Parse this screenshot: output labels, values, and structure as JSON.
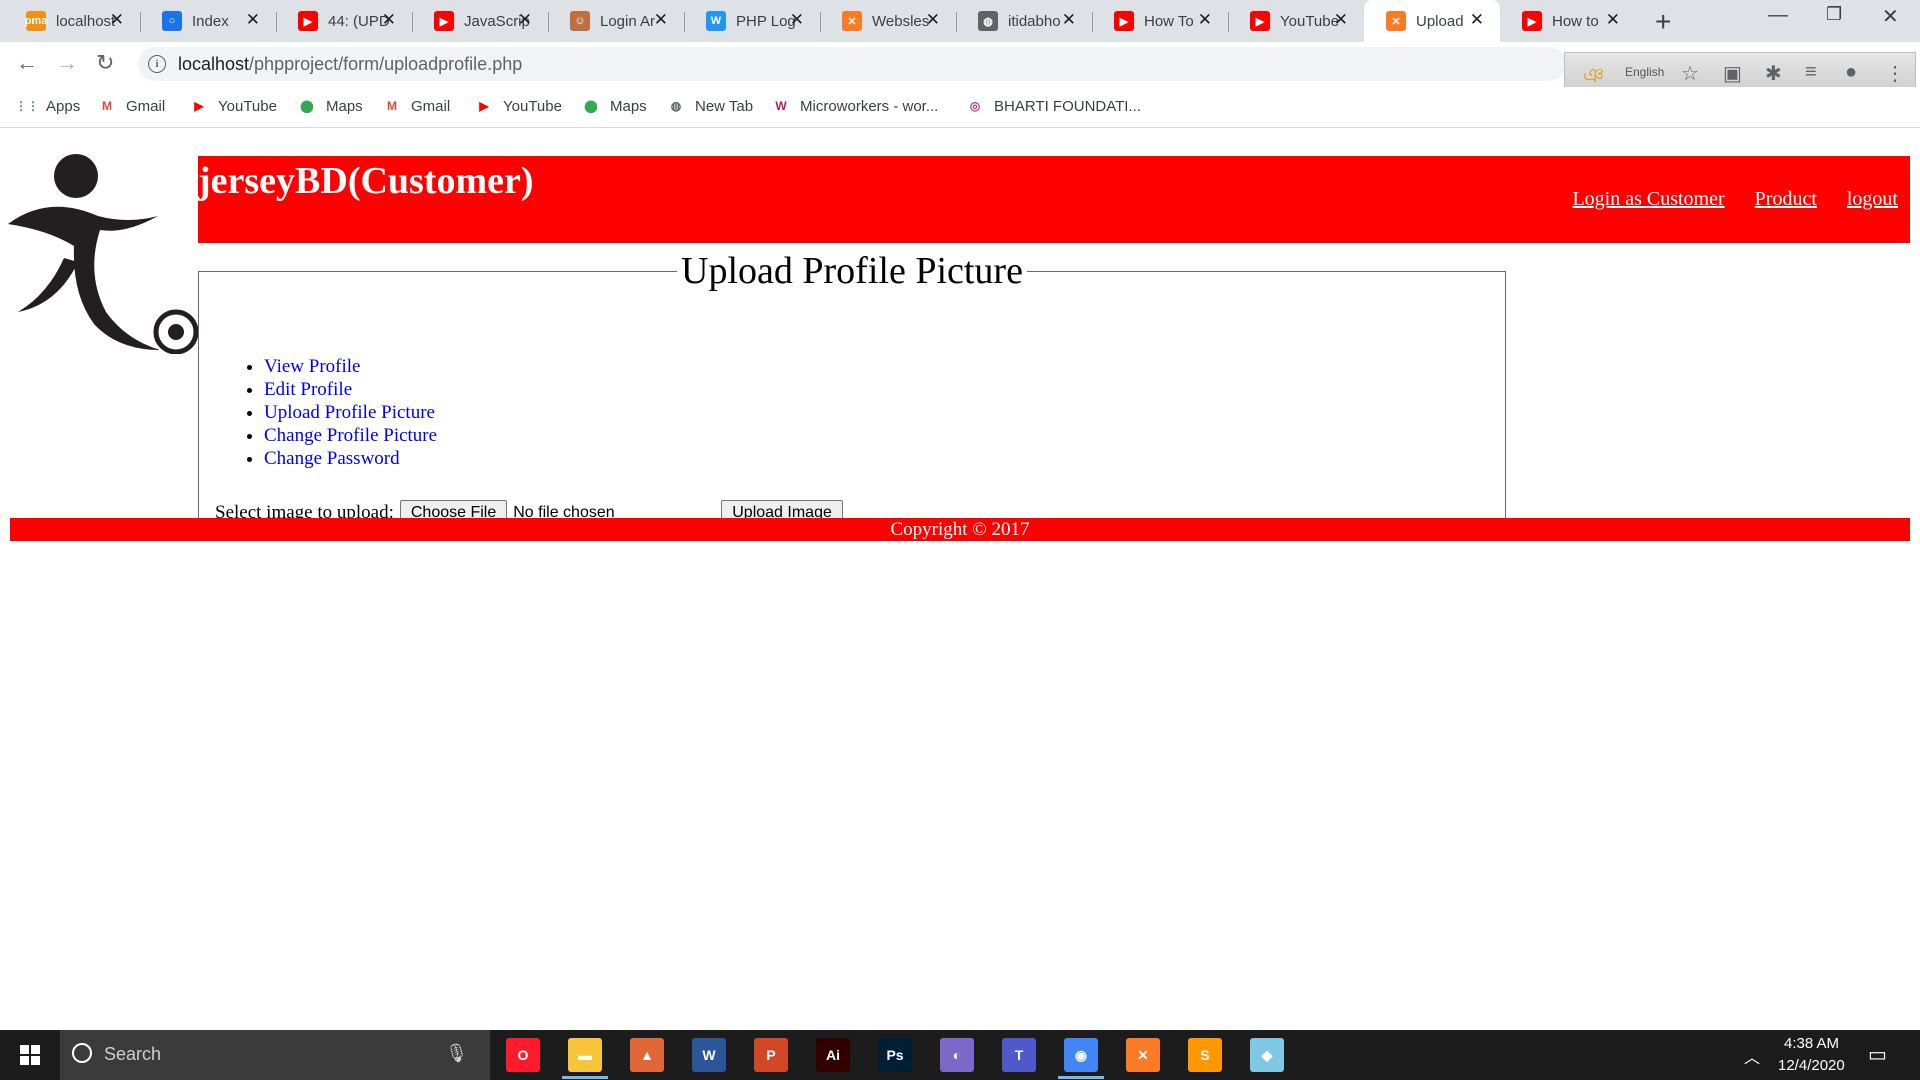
{
  "browser": {
    "tabs": [
      {
        "title": "localhost",
        "icon": "phpmyadmin-icon",
        "color": "#f29111",
        "glyph": "pma"
      },
      {
        "title": "Index",
        "icon": "globe-icon",
        "color": "#1a73e8",
        "glyph": "○"
      },
      {
        "title": "44: (UPD",
        "icon": "youtube-icon",
        "color": "#ff0000",
        "glyph": "▶"
      },
      {
        "title": "JavaScrip",
        "icon": "youtube-icon",
        "color": "#ff0000",
        "glyph": "▶"
      },
      {
        "title": "Login Ar",
        "icon": "avatar-icon",
        "color": "#c07040",
        "glyph": "☺"
      },
      {
        "title": "PHP Log",
        "icon": "w3schools-icon",
        "color": "#2196f3",
        "glyph": "W"
      },
      {
        "title": "Websles",
        "icon": "xampp-icon",
        "color": "#fb7a24",
        "glyph": "✕"
      },
      {
        "title": "itidabho",
        "icon": "globe-icon",
        "color": "#5f6368",
        "glyph": "◍"
      },
      {
        "title": "How To",
        "icon": "youtube-icon",
        "color": "#ff0000",
        "glyph": "▶"
      },
      {
        "title": "YouTube",
        "icon": "youtube-icon",
        "color": "#ff0000",
        "glyph": "▶"
      },
      {
        "title": "Upload",
        "icon": "xampp-icon",
        "color": "#fb7a24",
        "glyph": "✕",
        "active": true
      },
      {
        "title": "How to",
        "icon": "youtube-icon",
        "color": "#ff0000",
        "glyph": "▶"
      }
    ],
    "new_tab_glyph": "+",
    "close_glyph": "✕",
    "url_host": "localhost",
    "url_path": "/phpproject/form/uploadprofile.php",
    "ext_language": "English"
  },
  "bookmarks": [
    {
      "label": "Apps",
      "icon": "apps-grid-icon",
      "color": "#4285f4",
      "glyph": "⋮⋮"
    },
    {
      "label": "Gmail",
      "icon": "gmail-icon",
      "color": "#ea4335",
      "glyph": "M"
    },
    {
      "label": "YouTube",
      "icon": "youtube-icon",
      "color": "#ff0000",
      "glyph": "▶"
    },
    {
      "label": "Maps",
      "icon": "maps-pin-icon",
      "color": "#34a853",
      "glyph": "⬤"
    },
    {
      "label": "Gmail",
      "icon": "gmail-icon",
      "color": "#ea4335",
      "glyph": "M"
    },
    {
      "label": "YouTube",
      "icon": "youtube-icon",
      "color": "#ff0000",
      "glyph": "▶"
    },
    {
      "label": "Maps",
      "icon": "maps-pin-icon",
      "color": "#34a853",
      "glyph": "⬤"
    },
    {
      "label": "New Tab",
      "icon": "globe-icon",
      "color": "#5f6368",
      "glyph": "◍"
    },
    {
      "label": "Microworkers - wor...",
      "icon": "microworkers-icon",
      "color": "#c2185b",
      "glyph": "W"
    },
    {
      "label": "BHARTI FOUNDATI...",
      "icon": "instagram-icon",
      "color": "#c13584",
      "glyph": "◎"
    }
  ],
  "site": {
    "brand": "jerseyBD(Customer)",
    "nav": [
      "Login as Customer",
      "Product",
      "logout"
    ],
    "legend": "Upload Profile Picture",
    "menu": [
      "View Profile",
      "Edit Profile",
      "Upload Profile Picture",
      "Change Profile Picture",
      "Change Password"
    ],
    "upload_label": "Select image to upload:",
    "choose_file": "Choose File",
    "no_file": "No file chosen",
    "upload_button": "Upload Image",
    "footer": "Copyright © 2017",
    "header_color": "#ff0000"
  },
  "taskbar": {
    "search_placeholder": "Search",
    "apps": [
      {
        "name": "opera-icon",
        "color": "#ff1b2d",
        "glyph": "O"
      },
      {
        "name": "file-explorer-icon",
        "color": "#f8c43a",
        "glyph": "▬"
      },
      {
        "name": "matlab-icon",
        "color": "#e16737",
        "glyph": "▲"
      },
      {
        "name": "word-icon",
        "color": "#2b579a",
        "glyph": "W"
      },
      {
        "name": "powerpoint-icon",
        "color": "#d24726",
        "glyph": "P"
      },
      {
        "name": "illustrator-icon",
        "color": "#330000",
        "glyph": "Ai"
      },
      {
        "name": "photoshop-icon",
        "color": "#001e36",
        "glyph": "Ps"
      },
      {
        "name": "eclipse-icon",
        "color": "#7b68c9",
        "glyph": "◐"
      },
      {
        "name": "teams-icon",
        "color": "#5059c9",
        "glyph": "T"
      },
      {
        "name": "chrome-icon",
        "color": "#4285f4",
        "glyph": "◉"
      },
      {
        "name": "xampp-icon",
        "color": "#fb7a24",
        "glyph": "✕"
      },
      {
        "name": "sublime-icon",
        "color": "#ff9800",
        "glyph": "S"
      },
      {
        "name": "glass-app-icon",
        "color": "#7ec8e3",
        "glyph": "◆"
      }
    ],
    "time": "4:38 AM",
    "date": "12/4/2020"
  }
}
